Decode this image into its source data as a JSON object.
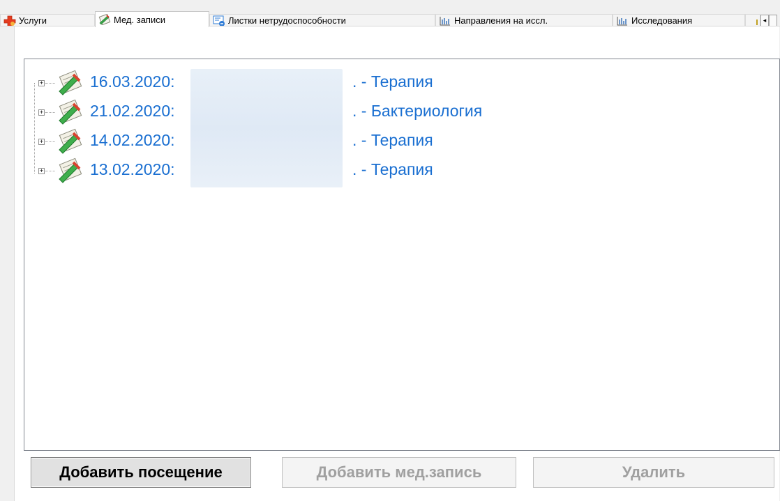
{
  "tabs": [
    {
      "label": "Услуги",
      "icon": "red-cross-icon",
      "active": false
    },
    {
      "label": "Мед. записи",
      "icon": "medical-record-icon",
      "active": true
    },
    {
      "label": "Листки нетрудоспособности",
      "icon": "sick-leave-icon",
      "active": false
    },
    {
      "label": "Направления на иссл.",
      "icon": "research-chart-icon",
      "active": false
    },
    {
      "label": "Исследования",
      "icon": "research-chart-icon",
      "active": false
    }
  ],
  "tab_scroll": {
    "left_glyph": "◂",
    "right_glyph": ""
  },
  "records": [
    {
      "date": "16.03.2020:",
      "department": ". - Терапия"
    },
    {
      "date": "21.02.2020:",
      "department": ". - Бактериология"
    },
    {
      "date": "14.02.2020:",
      "department": ". - Терапия"
    },
    {
      "date": "13.02.2020:",
      "department": ". - Терапия"
    }
  ],
  "expander_glyph": "+",
  "buttons": {
    "add_visit": "Добавить посещение",
    "add_record": "Добавить мед.запись",
    "delete": "Удалить"
  },
  "colors": {
    "link": "#1a6fd1",
    "disabled_text": "#a0a0a0",
    "border": "#828790"
  }
}
